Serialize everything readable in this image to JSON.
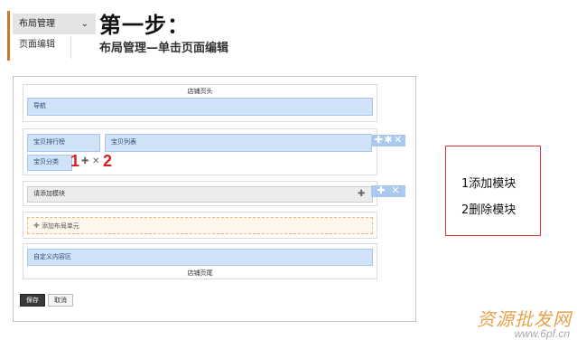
{
  "menu": {
    "title": "布局管理",
    "chevron": "⌄",
    "item": "页面编辑"
  },
  "step": {
    "title": "第一步：",
    "desc": "布局管理—单击页面编辑"
  },
  "editor": {
    "header_label": "店铺页头",
    "nav_label": "导航",
    "module_rank": "宝贝排行榜",
    "module_list": "宝贝列表",
    "module_category": "宝贝分类",
    "add_module": "请添加模块",
    "add_layout_unit": "添加布局单元",
    "custom_area": "自定义内容区",
    "footer_label": "店铺页尾",
    "save": "保存",
    "cancel": "取消",
    "num1": "1",
    "num2": "2"
  },
  "note": {
    "line1": "1添加模块",
    "line2": "2删除模块"
  },
  "watermark": {
    "text": "资源批发网",
    "url": "www.6pf.cn"
  }
}
